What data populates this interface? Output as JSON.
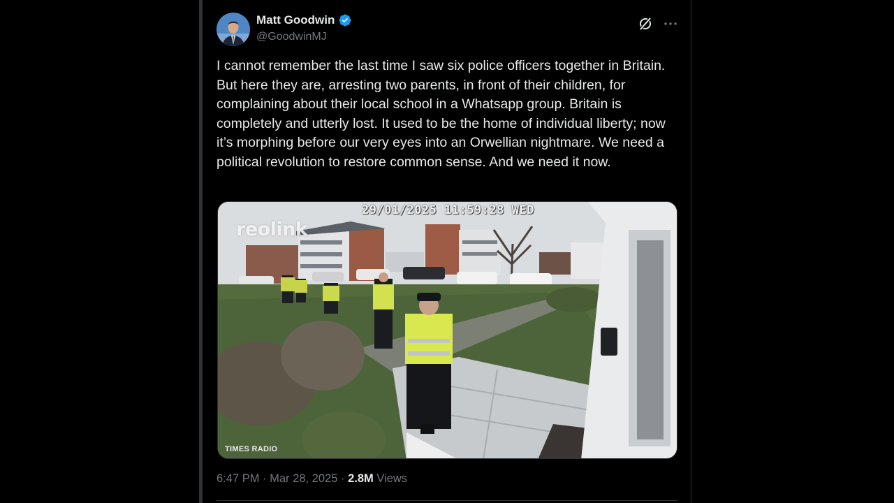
{
  "author": {
    "display_name": "Matt Goodwin",
    "handle": "@GoodwinMJ",
    "verified": true,
    "avatar_icon": "profile-photo",
    "verified_color": "#1d9bf0"
  },
  "actions": {
    "grok_icon": "grok-icon",
    "more_icon": "more-icon"
  },
  "tweet": {
    "text": "I cannot remember the last time I saw six police officers together in Britain. But here they are, arresting two parents, in front of their children, for complaining about their local school in a Whatsapp group. Britain is completely and utterly lost. It used to be the home of individual liberty; now it’s morphing before our very eyes into an Orwellian nightmare. We need a political revolution to restore common sense. And we need it now."
  },
  "media": {
    "timestamp": "29/01/2025 11:59:28 WED",
    "camera_brand": "reolink",
    "credit": "TIMES RADIO"
  },
  "meta": {
    "time": "6:47 PM",
    "separator": "·",
    "date": "Mar 28, 2025",
    "views_count": "2.8M",
    "views_label": "Views"
  },
  "colors": {
    "background": "#000000",
    "text": "#e7e9ea",
    "secondary_text": "#71767b",
    "border": "#2f3336"
  }
}
